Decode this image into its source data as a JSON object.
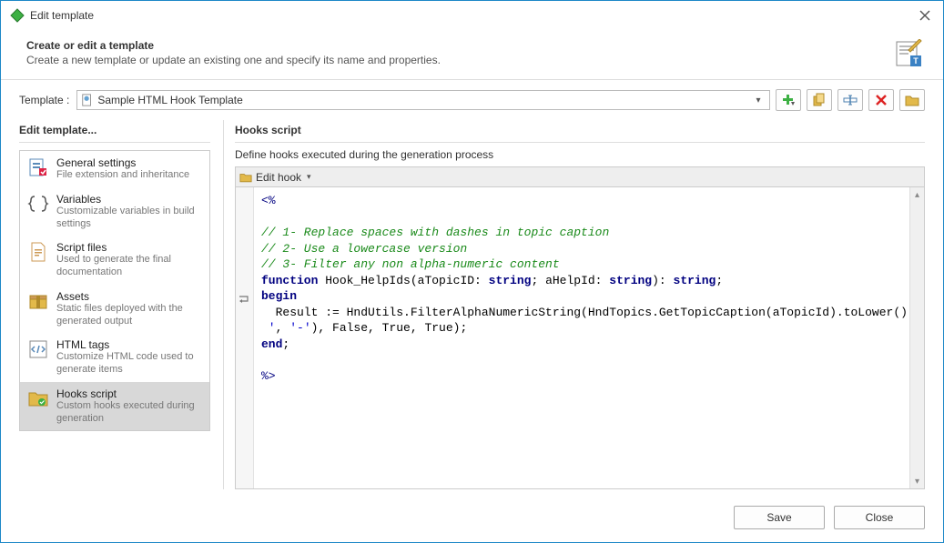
{
  "window": {
    "title": "Edit template",
    "close_icon": "close"
  },
  "header": {
    "title": "Create or edit a template",
    "subtitle": "Create a new template or update an existing one and specify its name and properties."
  },
  "template_row": {
    "label": "Template :",
    "selected": "Sample HTML Hook Template"
  },
  "toolbar_buttons": {
    "add": "add",
    "copy": "copy",
    "rename": "rename",
    "delete": "delete",
    "open": "open"
  },
  "left_panel": {
    "title": "Edit template..."
  },
  "nav": [
    {
      "title": "General settings",
      "desc": "File extension and inheritance",
      "icon": "settings"
    },
    {
      "title": "Variables",
      "desc": "Customizable variables in build settings",
      "icon": "braces"
    },
    {
      "title": "Script files",
      "desc": "Used to generate the final documentation",
      "icon": "file"
    },
    {
      "title": "Assets",
      "desc": "Static files deployed with the generated output",
      "icon": "package"
    },
    {
      "title": "HTML tags",
      "desc": "Customize HTML code used to generate items",
      "icon": "tags"
    },
    {
      "title": "Hooks script",
      "desc": "Custom hooks executed during generation",
      "icon": "folder-script"
    }
  ],
  "right_panel": {
    "title": "Hooks script",
    "desc": "Define hooks executed during the generation process",
    "edit_hook_label": "Edit hook"
  },
  "code": {
    "l1": "<%",
    "l2": "",
    "l3": "// 1- Replace spaces with dashes in topic caption",
    "l4": "// 2- Use a lowercase version",
    "l5": "// 3- Filter any non alpha-numeric content",
    "kw_function": "function",
    "fn_name": " Hook_HelpIds(aTopicID: ",
    "kw_string1": "string",
    "fn_mid": "; aHelpId: ",
    "kw_string2": "string",
    "fn_tail": "): ",
    "kw_string3": "string",
    "fn_semi": ";",
    "kw_begin": "begin",
    "body1a": "  Result := HndUtils.FilterAlphaNumericString(HndTopics.GetTopicCaption(aTopicId).toLower().replace(",
    "body1b": "'",
    "body2a": " '",
    "body2b": ", ",
    "body2c": "'-'",
    "body2d": "), False, True, True);",
    "kw_end": "end",
    "end_semi": ";",
    "lclose": "%>"
  },
  "footer": {
    "save": "Save",
    "close": "Close"
  }
}
